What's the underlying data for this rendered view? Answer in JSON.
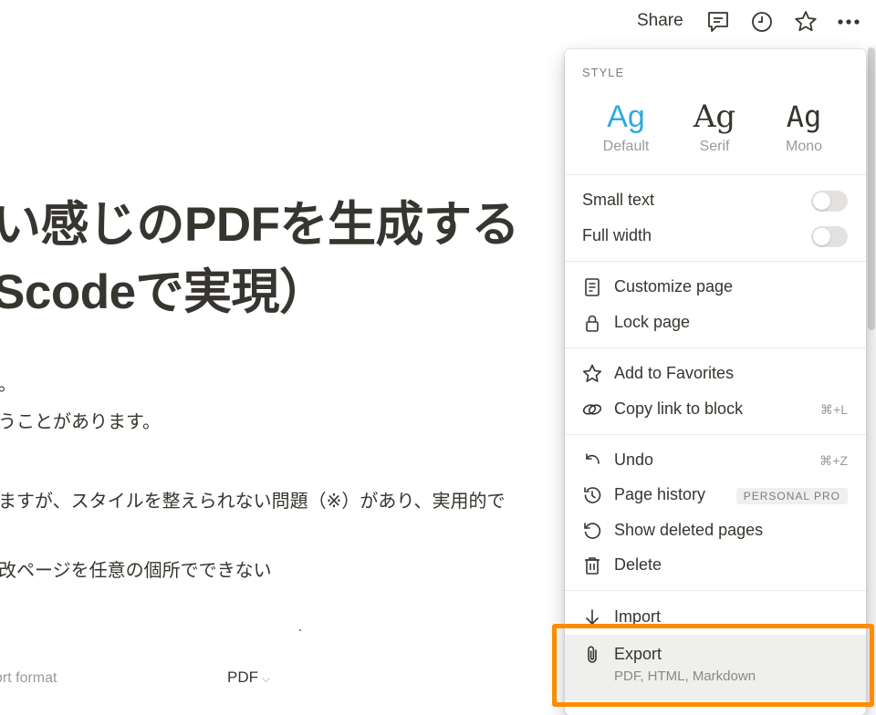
{
  "topbar": {
    "share_label": "Share",
    "icons": [
      "comment-icon",
      "clock-icon",
      "star-icon",
      "more-icon"
    ]
  },
  "content": {
    "title_line1": "い感じのPDFを生成する",
    "title_line2": "Scodeで実現）",
    "paragraphs": [
      "。",
      "うことがあります。",
      "ますが、スタイルを整えられない問題（※）があり、実用的で",
      "改ページを任意の個所でできない"
    ],
    "property_label": "ort format",
    "property_value": "PDF"
  },
  "menu": {
    "style_heading": "STYLE",
    "fonts": [
      {
        "glyph": "Ag",
        "name": "Default",
        "active": true
      },
      {
        "glyph": "Ag",
        "name": "Serif",
        "active": false
      },
      {
        "glyph": "Ag",
        "name": "Mono",
        "active": false
      }
    ],
    "small_text": "Small text",
    "full_width": "Full width",
    "customize_page": "Customize page",
    "lock_page": "Lock page",
    "add_favorites": "Add to Favorites",
    "copy_link": "Copy link to block",
    "copy_link_shortcut": "⌘+L",
    "undo": "Undo",
    "undo_shortcut": "⌘+Z",
    "page_history": "Page history",
    "page_history_badge": "PERSONAL PRO",
    "show_deleted": "Show deleted pages",
    "delete": "Delete",
    "import": "Import",
    "export": "Export",
    "export_sub": "PDF, HTML, Markdown"
  },
  "colors": {
    "accent": "#2eaadc",
    "highlight": "#ff8c00",
    "text": "#37352f",
    "muted": "#9b9a97"
  }
}
